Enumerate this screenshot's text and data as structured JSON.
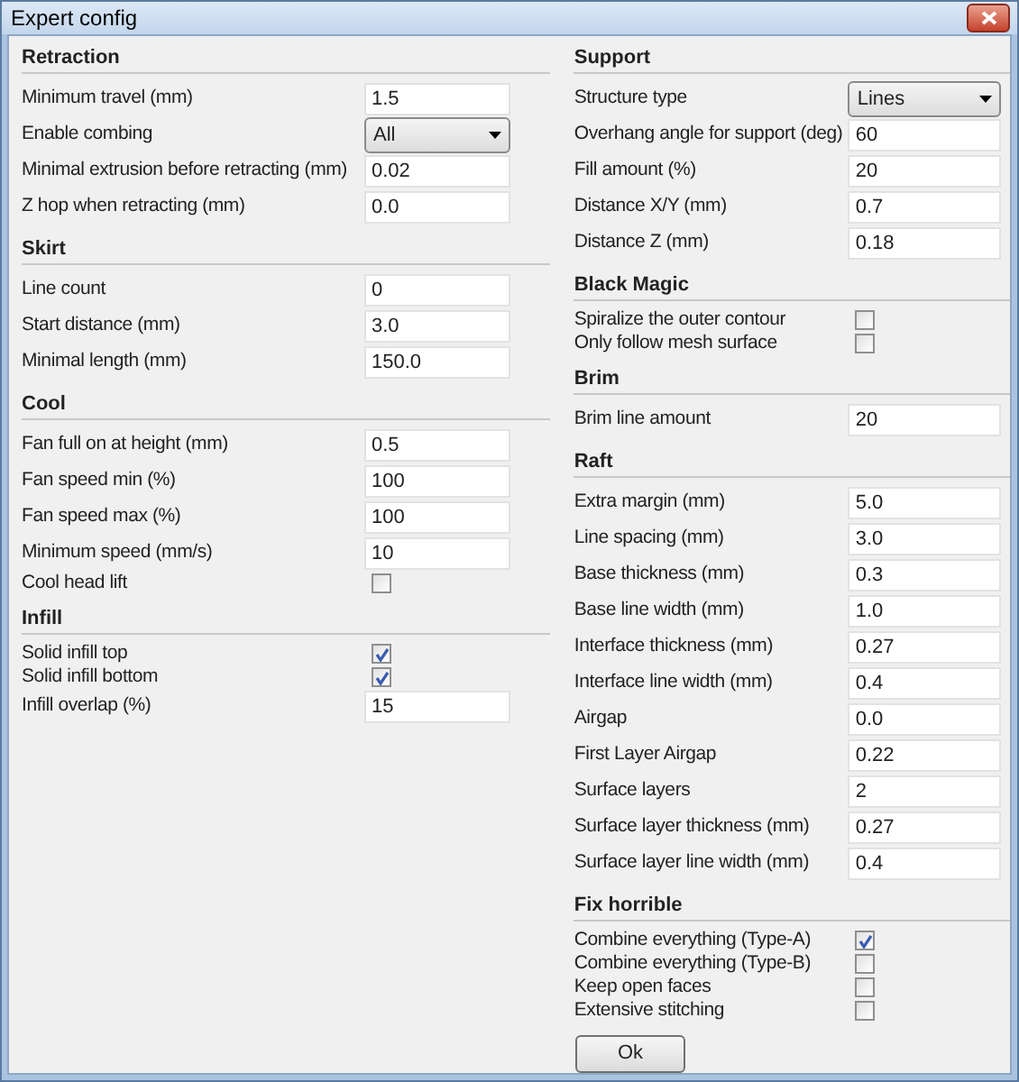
{
  "window": {
    "title": "Expert config"
  },
  "columns": [
    {
      "sections": [
        {
          "title": "Retraction",
          "rows": [
            {
              "kind": "text",
              "label": "Minimum travel (mm)",
              "value": "1.5"
            },
            {
              "kind": "select",
              "label": "Enable combing",
              "value": "All"
            },
            {
              "kind": "text",
              "label": "Minimal extrusion before retracting (mm)",
              "value": "0.02"
            },
            {
              "kind": "text",
              "label": "Z hop when retracting (mm)",
              "value": "0.0"
            }
          ]
        },
        {
          "title": "Skirt",
          "rows": [
            {
              "kind": "text",
              "label": "Line count",
              "value": "0"
            },
            {
              "kind": "text",
              "label": "Start distance (mm)",
              "value": "3.0"
            },
            {
              "kind": "text",
              "label": "Minimal length (mm)",
              "value": "150.0"
            }
          ]
        },
        {
          "title": "Cool",
          "rows": [
            {
              "kind": "text",
              "label": "Fan full on at height (mm)",
              "value": "0.5"
            },
            {
              "kind": "text",
              "label": "Fan speed min (%)",
              "value": "100"
            },
            {
              "kind": "text",
              "label": "Fan speed max (%)",
              "value": "100"
            },
            {
              "kind": "text",
              "label": "Minimum speed (mm/s)",
              "value": "10"
            },
            {
              "kind": "check",
              "label": "Cool head lift",
              "checked": false
            }
          ]
        },
        {
          "title": "Infill",
          "rows": [
            {
              "kind": "check",
              "label": "Solid infill top",
              "checked": true
            },
            {
              "kind": "check",
              "label": "Solid infill bottom",
              "checked": true
            },
            {
              "kind": "text",
              "label": "Infill overlap (%)",
              "value": "15"
            }
          ]
        }
      ]
    },
    {
      "sections": [
        {
          "title": "Support",
          "rows": [
            {
              "kind": "select",
              "label": "Structure type",
              "value": "Lines"
            },
            {
              "kind": "text",
              "label": "Overhang angle for support (deg)",
              "value": "60"
            },
            {
              "kind": "text",
              "label": "Fill amount (%)",
              "value": "20"
            },
            {
              "kind": "text",
              "label": "Distance X/Y (mm)",
              "value": "0.7"
            },
            {
              "kind": "text",
              "label": "Distance Z (mm)",
              "value": "0.18"
            }
          ]
        },
        {
          "title": "Black Magic",
          "rows": [
            {
              "kind": "check",
              "label": "Spiralize the outer contour",
              "checked": false
            },
            {
              "kind": "check",
              "label": "Only follow mesh surface",
              "checked": false
            }
          ]
        },
        {
          "title": "Brim",
          "rows": [
            {
              "kind": "text",
              "label": "Brim line amount",
              "value": "20"
            }
          ]
        },
        {
          "title": "Raft",
          "rows": [
            {
              "kind": "text",
              "label": "Extra margin (mm)",
              "value": "5.0"
            },
            {
              "kind": "text",
              "label": "Line spacing (mm)",
              "value": "3.0"
            },
            {
              "kind": "text",
              "label": "Base thickness (mm)",
              "value": "0.3"
            },
            {
              "kind": "text",
              "label": "Base line width (mm)",
              "value": "1.0"
            },
            {
              "kind": "text",
              "label": "Interface thickness (mm)",
              "value": "0.27"
            },
            {
              "kind": "text",
              "label": "Interface line width (mm)",
              "value": "0.4"
            },
            {
              "kind": "text",
              "label": "Airgap",
              "value": "0.0"
            },
            {
              "kind": "text",
              "label": "First Layer Airgap",
              "value": "0.22"
            },
            {
              "kind": "text",
              "label": "Surface layers",
              "value": "2"
            },
            {
              "kind": "text",
              "label": "Surface layer thickness (mm)",
              "value": "0.27"
            },
            {
              "kind": "text",
              "label": "Surface layer line width (mm)",
              "value": "0.4"
            }
          ]
        },
        {
          "title": "Fix horrible",
          "rows": [
            {
              "kind": "check",
              "label": "Combine everything (Type-A)",
              "checked": true
            },
            {
              "kind": "check",
              "label": "Combine everything (Type-B)",
              "checked": false
            },
            {
              "kind": "check",
              "label": "Keep open faces",
              "checked": false
            },
            {
              "kind": "check",
              "label": "Extensive stitching",
              "checked": false
            }
          ]
        }
      ]
    }
  ],
  "ok_button": "Ok"
}
